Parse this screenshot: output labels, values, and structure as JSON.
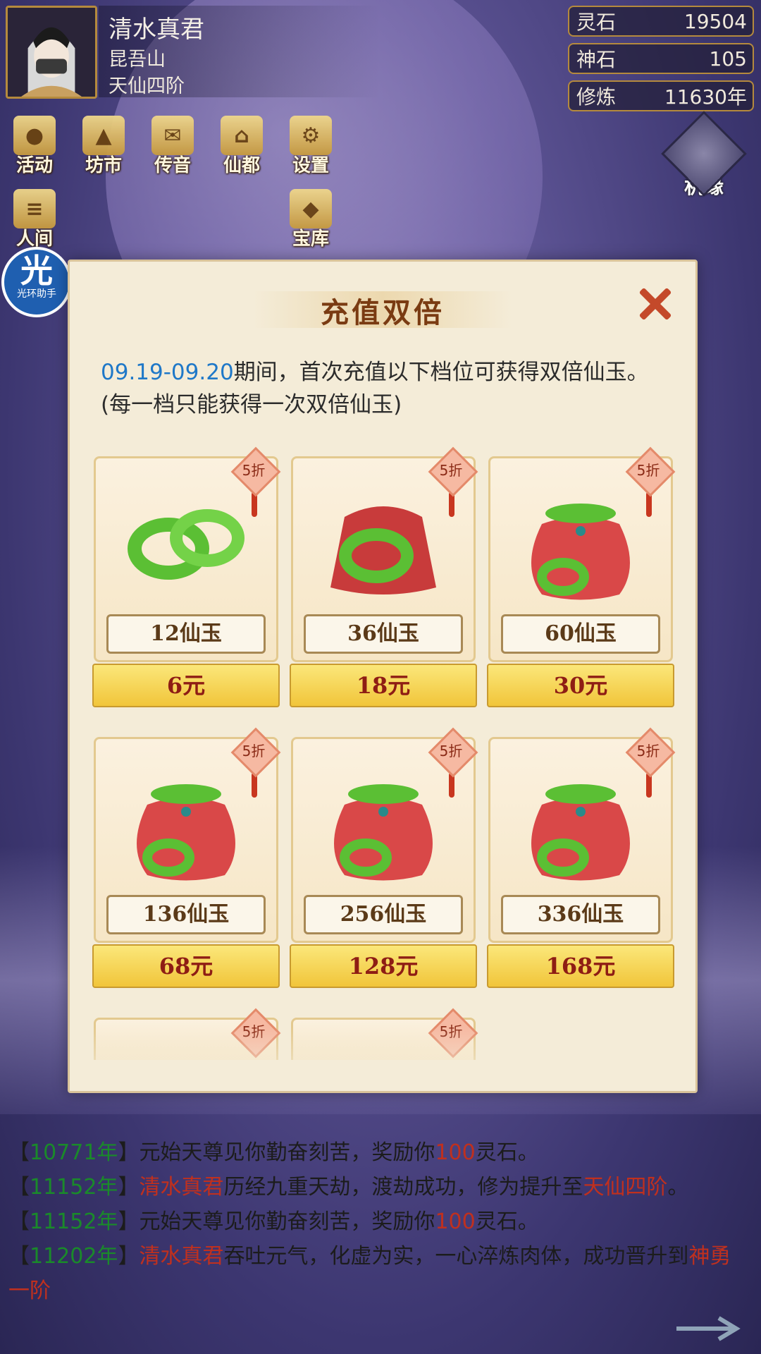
{
  "player": {
    "name": "清水真君",
    "sect": "昆吾山",
    "realm": "天仙四阶"
  },
  "resources": [
    {
      "label": "灵石",
      "value": "19504"
    },
    {
      "label": "神石",
      "value": "105"
    },
    {
      "label": "修炼",
      "value": "11630年"
    }
  ],
  "nav_row1": [
    {
      "label": "活动",
      "glyph": "●"
    },
    {
      "label": "坊市",
      "glyph": "▲"
    },
    {
      "label": "传音",
      "glyph": "✉"
    },
    {
      "label": "仙都",
      "glyph": "⌂"
    },
    {
      "label": "设置",
      "glyph": "⚙"
    }
  ],
  "nav_row2": [
    {
      "label": "人间",
      "glyph": "≡"
    },
    {
      "label": "宝库",
      "glyph": "◆"
    }
  ],
  "jiyuan_label": "机缘",
  "helper": {
    "glyph": "光",
    "label": "光环助手"
  },
  "modal": {
    "title": "充值双倍",
    "date_range": "09.19-09.20",
    "description": "期间，首次充值以下档位可获得双倍仙玉。(每一档只能获得一次双倍仙玉)",
    "discount": "5折",
    "packs": [
      {
        "amount": "12仙玉",
        "price": "6元",
        "item": "jade-rings"
      },
      {
        "amount": "36仙玉",
        "price": "18元",
        "item": "jade-pouch-open"
      },
      {
        "amount": "60仙玉",
        "price": "30元",
        "item": "jade-bag"
      },
      {
        "amount": "136仙玉",
        "price": "68元",
        "item": "jade-bag"
      },
      {
        "amount": "256仙玉",
        "price": "128元",
        "item": "jade-bag"
      },
      {
        "amount": "336仙玉",
        "price": "168元",
        "item": "jade-bag"
      }
    ]
  },
  "log": [
    {
      "year": "10771年",
      "parts": [
        {
          "t": "元始天尊见你勤奋刻苦，奖励你",
          "c": ""
        },
        {
          "t": "100",
          "c": "red"
        },
        {
          "t": "灵石。",
          "c": ""
        }
      ]
    },
    {
      "year": "11152年",
      "parts": [
        {
          "t": "清水真君",
          "c": "red"
        },
        {
          "t": "历经九重天劫，渡劫成功，修为提升至",
          "c": ""
        },
        {
          "t": "天仙四阶",
          "c": "red"
        },
        {
          "t": "。",
          "c": ""
        }
      ]
    },
    {
      "year": "11152年",
      "parts": [
        {
          "t": "元始天尊见你勤奋刻苦，奖励你",
          "c": ""
        },
        {
          "t": "100",
          "c": "red"
        },
        {
          "t": "灵石。",
          "c": ""
        }
      ]
    },
    {
      "year": "11202年",
      "parts": [
        {
          "t": "清水真君",
          "c": "red"
        },
        {
          "t": "吞吐元气，化虚为实，一心淬炼肉体，成功晋升到",
          "c": ""
        },
        {
          "t": "神勇一阶",
          "c": "red"
        }
      ]
    }
  ]
}
